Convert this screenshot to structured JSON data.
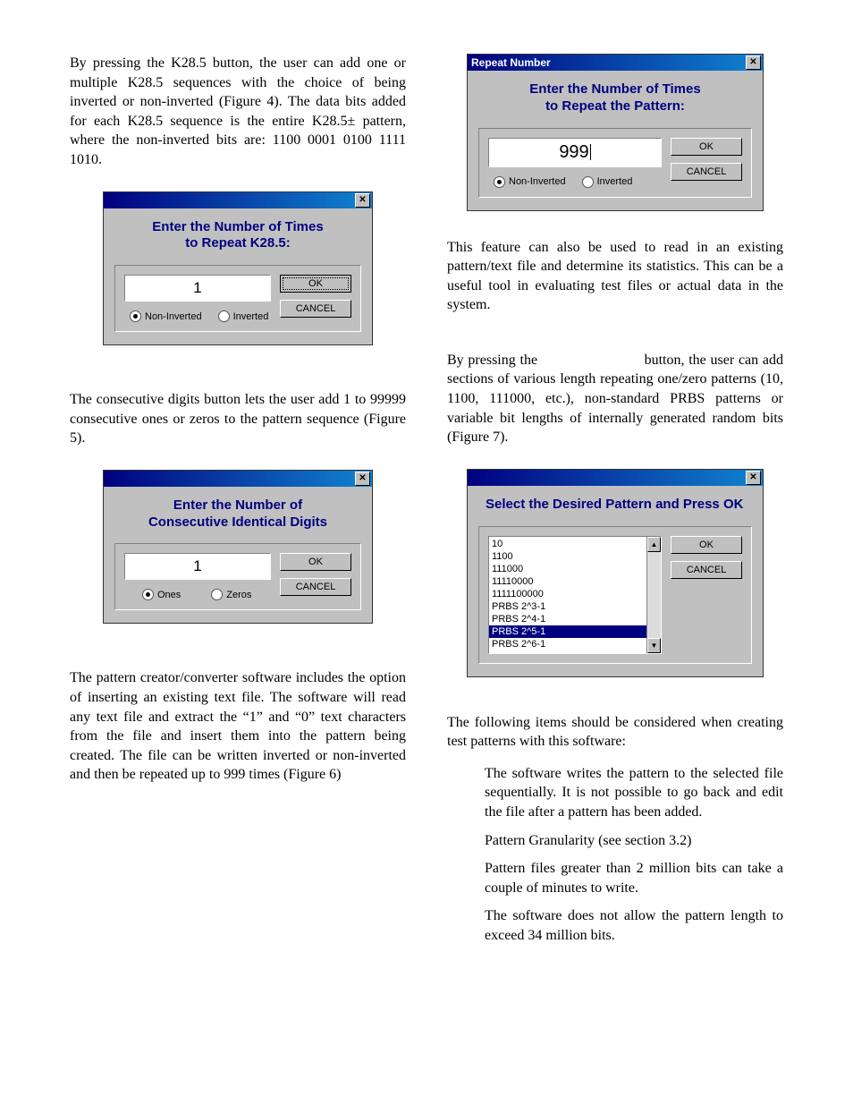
{
  "left": {
    "p1": "By pressing the K28.5 button, the user can add one or multiple K28.5 sequences with the choice of being inverted or non-inverted (Figure 4). The data bits added for each K28.5 sequence is the entire K28.5± pattern, where the non-inverted bits are: 1100 0001 0100 1111 1010.",
    "p2": "The consecutive digits button lets the user add 1 to 99999 consecutive ones or zeros to the pattern sequence (Figure 5).",
    "p3": "The pattern creator/converter software includes the option of inserting an existing text file. The software will read any text file and extract the “1” and “0” text characters from the file and insert them into the pattern being created. The file can be written inverted or non-inverted and then be repeated up to 999 times (Figure 6)"
  },
  "right": {
    "p1": "This feature can also be used to read in an existing pattern/text file and determine its statistics. This can be a useful tool in evaluating test files or actual data in the system.",
    "p2a": "By pressing the",
    "p2b": "button, the user can add sections of various length repeating one/zero patterns (10, 1100, 111000, etc.), non-standard PRBS patterns or variable bit lengths of internally generated random bits (Figure 7).",
    "p3": "The following items should be considered when creating test patterns with this software:",
    "bullets": [
      "The software writes the pattern to the selected file sequentially. It is not possible to go back and edit the file after a pattern has been added.",
      "Pattern Granularity (see section 3.2)",
      "Pattern files greater than 2 million bits can take a couple of minutes to write.",
      "The software does not allow the pattern length to exceed 34 million bits."
    ]
  },
  "dlg4": {
    "title": "",
    "header": "Enter the Number of Times\nto Repeat K28.5:",
    "value": "1",
    "radioA": "Non-Inverted",
    "radioB": "Inverted",
    "ok": "OK",
    "cancel": "CANCEL"
  },
  "dlg5": {
    "header": "Enter the Number of\nConsecutive Identical Digits",
    "value": "1",
    "radioA": "Ones",
    "radioB": "Zeros",
    "ok": "OK",
    "cancel": "CANCEL"
  },
  "dlg6": {
    "title": "Repeat Number",
    "header": "Enter the Number of Times\nto Repeat the Pattern:",
    "value": "999",
    "radioA": "Non-Inverted",
    "radioB": "Inverted",
    "ok": "OK",
    "cancel": "CANCEL"
  },
  "dlg7": {
    "header": "Select the Desired Pattern and Press OK",
    "items": [
      "10",
      "1100",
      "111000",
      "11110000",
      "1111100000",
      "PRBS 2^3-1",
      "PRBS 2^4-1",
      "PRBS 2^5-1",
      "PRBS 2^6-1"
    ],
    "selected": 7,
    "ok": "OK",
    "cancel": "CANCEL"
  }
}
